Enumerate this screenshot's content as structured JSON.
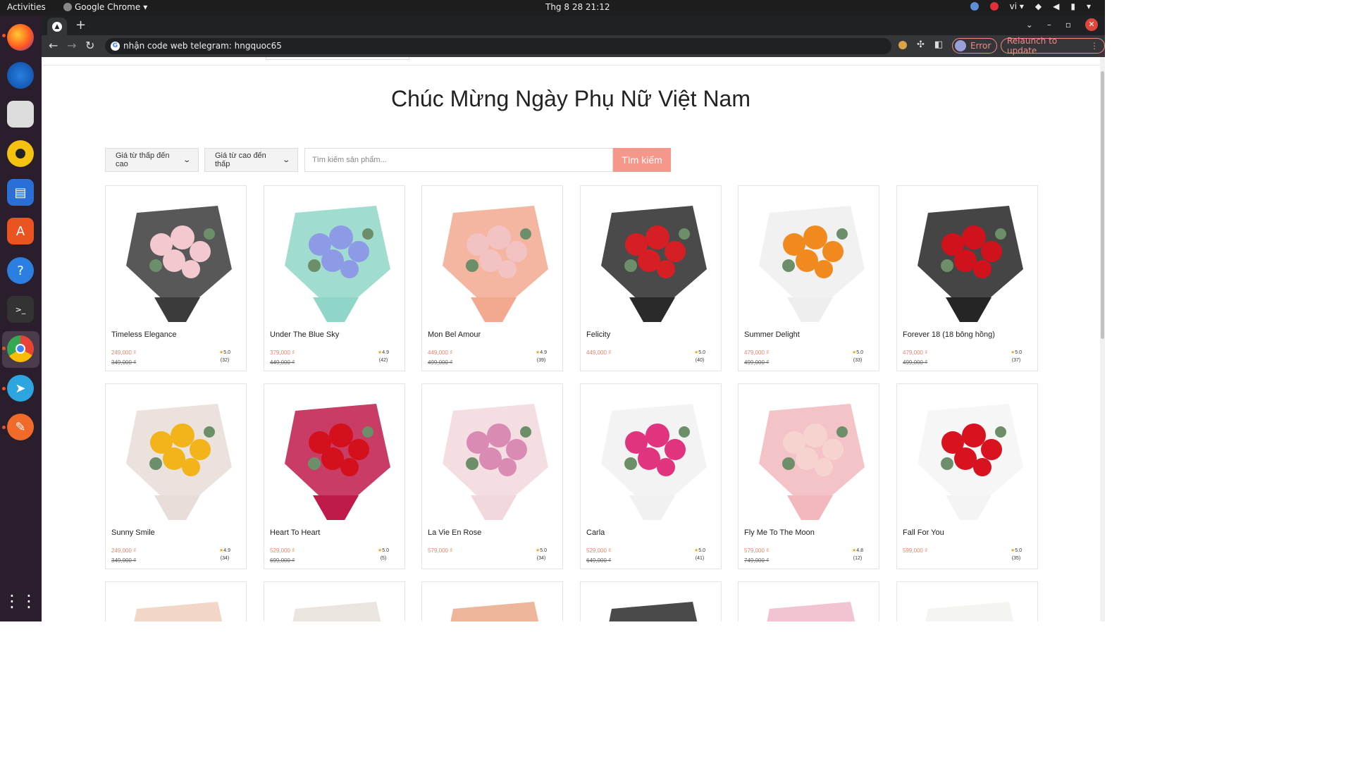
{
  "system": {
    "activities": "Activities",
    "app_name": "Google Chrome",
    "clock": "Thg 8 28  21:12",
    "lang": "vi"
  },
  "browser": {
    "url": "nhận code web telegram: hngquoc65",
    "error_label": "Error",
    "relaunch_label": "Relaunch to update"
  },
  "page": {
    "title": "Chúc Mừng Ngày Phụ Nữ Việt Nam",
    "sort_asc": "Giá từ thấp đến cao",
    "sort_desc": "Giá từ cao đến thấp",
    "search_placeholder": "Tìm kiếm sản phẩm...",
    "search_button": "Tìm kiếm"
  },
  "colors": {
    "accent": "#f5978a",
    "price": "#f08070",
    "star": "#e6a817"
  },
  "products": [
    {
      "name": "Timeless Elegance",
      "price": "249,000 ₫",
      "old_price": "349,000 ₫",
      "rating": "5.0",
      "reviews": "(32)",
      "wrap": "#3b3b3b",
      "flower": "#f3c9cf"
    },
    {
      "name": "Under The Blue Sky",
      "price": "379,000 ₫",
      "old_price": "449,000 ₫",
      "rating": "4.9",
      "reviews": "(42)",
      "wrap": "#8fd6c8",
      "flower": "#8d9be6"
    },
    {
      "name": "Mon Bel Amour",
      "price": "449,000 ₫",
      "old_price": "499,000 ₫",
      "rating": "4.9",
      "reviews": "(39)",
      "wrap": "#f2a98f",
      "flower": "#f3c2c2"
    },
    {
      "name": "Felicity",
      "price": "449,000 ₫",
      "old_price": "",
      "rating": "5.0",
      "reviews": "(40)",
      "wrap": "#2a2a2a",
      "flower": "#d61f25"
    },
    {
      "name": "Summer Delight",
      "price": "479,000 ₫",
      "old_price": "499,000 ₫",
      "rating": "5.0",
      "reviews": "(33)",
      "wrap": "#eeeeee",
      "flower": "#f08a1e"
    },
    {
      "name": "Forever 18 (18 bông hồng)",
      "price": "479,000 ₫",
      "old_price": "499,000 ₫",
      "rating": "5.0",
      "reviews": "(37)",
      "wrap": "#252525",
      "flower": "#d0121c"
    },
    {
      "name": "Sunny Smile",
      "price": "249,000 ₫",
      "old_price": "349,000 ₫",
      "rating": "4.9",
      "reviews": "(34)",
      "wrap": "#e8ddd8",
      "flower": "#f2b41a"
    },
    {
      "name": "Heart To Heart",
      "price": "529,000 ₫",
      "old_price": "699,000 ₫",
      "rating": "5.0",
      "reviews": "(5)",
      "wrap": "#c01a4a",
      "flower": "#d3101c"
    },
    {
      "name": "La Vie En Rose",
      "price": "579,000 ₫",
      "old_price": "",
      "rating": "5.0",
      "reviews": "(34)",
      "wrap": "#f2d8dc",
      "flower": "#d98bb4"
    },
    {
      "name": "Carla",
      "price": "529,000 ₫",
      "old_price": "649,000 ₫",
      "rating": "5.0",
      "reviews": "(41)",
      "wrap": "#f1f1f1",
      "flower": "#e0347f"
    },
    {
      "name": "Fly Me To The Moon",
      "price": "579,000 ₫",
      "old_price": "749,000 ₫",
      "rating": "4.8",
      "reviews": "(12)",
      "wrap": "#f2b8bd",
      "flower": "#f7d3d0"
    },
    {
      "name": "Fall For You",
      "price": "599,000 ₫",
      "old_price": "",
      "rating": "5.0",
      "reviews": "(35)",
      "wrap": "#f4f4f4",
      "flower": "#d8121f"
    },
    {
      "wrap": "#f0d0c0",
      "flower": "#cc1010"
    },
    {
      "wrap": "#e8e0da",
      "flower": "#eab8b8"
    },
    {
      "wrap": "#eaa98a",
      "flower": "#eaa98a"
    },
    {
      "wrap": "#2a2a2a",
      "flower": "#cc1a1a"
    },
    {
      "wrap": "#f0b8c8",
      "flower": "#d873a0"
    },
    {
      "wrap": "#f2f2ee",
      "flower": "#d01a1a"
    }
  ]
}
